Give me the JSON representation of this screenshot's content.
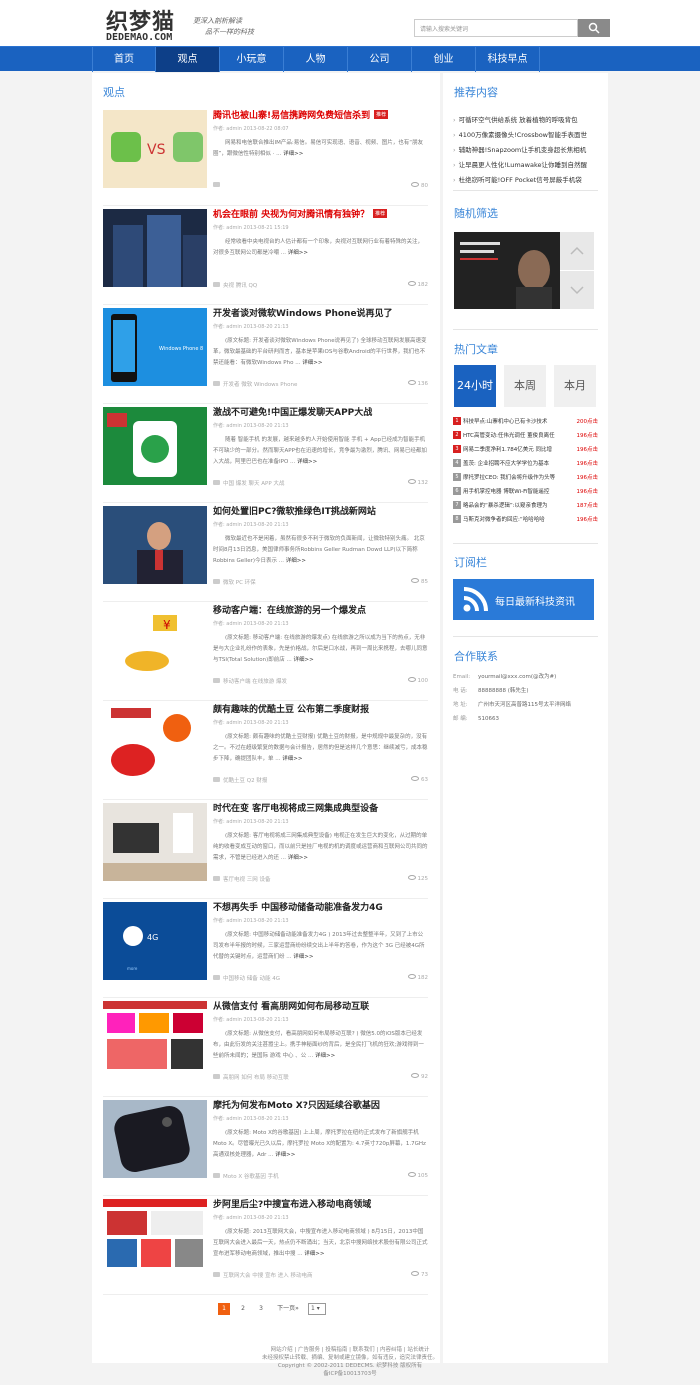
{
  "header": {
    "logo_cn": "织梦猫",
    "logo_en": "DEDEMAO.COM",
    "slogan1": "更深入剖析解读",
    "slogan2": "品不一样的科技",
    "search_placeholder": "请输入搜索关键词"
  },
  "nav": [
    "首页",
    "观点",
    "小玩意",
    "人物",
    "公司",
    "创业",
    "科技早点"
  ],
  "nav_active": "观点",
  "main": {
    "section_title": "观点",
    "articles": [
      {
        "title": "腾讯也被山寨!易信携跨网免费短信杀到",
        "hot": "推荐",
        "meta": "作者: admin  2013-08-22 08:07",
        "summary": "网易和电信联合推出IM产品:易信。易信可实现语、语音、视频、图片，也有“朋友圈”，跟微信性特别相似 · ...",
        "tags": "",
        "views": "80"
      },
      {
        "title": "机会在眼前 央视为何对腾讯情有独钟？",
        "hot": "推荐",
        "meta": "作者: admin  2013-08-21 15:19",
        "summary": "经常收看中央电视台的人估计都有一个印象，央视对互联网行业有着特殊的关注，对很多互联网公司都是冷嘲 ...",
        "tags": "央视  腾讯  QQ",
        "views": "182"
      },
      {
        "title": "开发者谈对微软Windows Phone说再见了",
        "hot": "",
        "meta": "作者: admin  2013-08-20 21:13",
        "summary": "(原文标题: 开发者谈对微软Windows Phone说再见了) 全球移动互联网发展高速变革，微软最基础的平台研判而言，基本是苹果iOS与谷歌Android的平行世界，我们也不禁还能看：有微软Windows Pho ...",
        "tags": "开发者  微软  Windows Phone",
        "views": "136"
      },
      {
        "title": "激战不可避免!中国正爆发聊天APP大战",
        "hot": "",
        "meta": "作者: admin  2013-08-20 21:13",
        "summary": "随着 智能手机 的发展，越来越多的人开始使用智能 手机 + App已经成为智能手机不可缺少的一部分。然而聊天APP也在迅速的增长，竞争最为激烈，腾讯、网易已经都加入大战，阿里巴巴也在准备IPO ...",
        "tags": "中国  爆发  聊天  APP  大战",
        "views": "132"
      },
      {
        "title": "如何处置旧PC?微软推绿色IT挑战新网站",
        "hot": "",
        "meta": "作者: admin  2013-08-20 21:13",
        "summary": "微软最近也不是闲着，虽然有很多不利于微软的负面新闻，让微软特别头痛。 北京时间8月13日消息，美国律师事务所Robbins Geller Rudman Dowd LLP(以下简称Robbins Geller)今日表示 ...",
        "tags": "微软  PC  环保",
        "views": "85"
      },
      {
        "title": "移动客户端：在线旅游的另一个爆发点",
        "hot": "",
        "meta": "作者: admin  2013-08-20 21:13",
        "summary": "(原文标题: 移动客户端: 在线旅游的爆发点) 在线旅游之所以成为当下的热点，无非是与大企业扎纷作的表象，先是价格战，尔后是口水战，再到一周比来携程，去哪儿同意与TSI(Total Solution)即前店 ...",
        "tags": "移动客户端  在线旅游  爆发",
        "views": "100"
      },
      {
        "title": "颇有趣味的优酷土豆 公布第二季度财报",
        "hot": "",
        "meta": "作者: admin  2013-08-20 21:13",
        "summary": "(原文标题: 颇有趣味的优酷土豆财报) 优酷土豆的财报，是中规规中最复杂的，没有之一。不过在超级繁复的数据与会计报告，居然的但是这样几个意思：继续减亏，成本稳步下降，确提团队丰，单 ...",
        "tags": "优酷土豆  Q2  财报",
        "views": "63"
      },
      {
        "title": "时代在变 客厅电视将成三网集成典型设备",
        "hot": "",
        "meta": "作者: admin  2013-08-20 21:13",
        "summary": "(原文标题: 客厅电视将成三网集成典型设备) 电视正在发生巨大的变化，从过期的单纯的收看变成互动的窗口，而以前只是挂厂电视的机的调度或运营商和互联网公司共同的需求，不管是已经进入的还 ...",
        "tags": "客厅电视  三网  设备",
        "views": "125"
      },
      {
        "title": "不想再失手 中国移动储备动能准备发力4G",
        "hot": "",
        "meta": "作者: admin  2013-08-20 21:13",
        "summary": "(原文标题: 中国移动储备动能准备发力4G ) 2013年过去整整半年，又到了上市公司发布半年报的时候，三家运营商纷纷续交出上半年的答卷，作为这个 3G 已经被4G所代替的关键时点，运营商们纷 ...",
        "tags": "中国移动  储备  动能  4G",
        "views": "182"
      },
      {
        "title": "从微信支付 看高朋网如何布局移动互联",
        "hot": "",
        "meta": "作者: admin  2013-08-20 21:13",
        "summary": "(原文标题: 从微信支付，看高朋网如何布局移动互联? ) 微信5.0的iOS版本已经发布，由此衍发的关注甚嚣尘上。携手神秘面纱的背后，是全民打飞机的狂欢;游戏得到一些前所未闻的；是国际 游戏 中心 、公 ...",
        "tags": "高朋网  如何  布局  移动互联",
        "views": "92"
      },
      {
        "title": "摩托为何发布Moto X?只因延续谷歌基因",
        "hot": "",
        "meta": "作者: admin  2013-08-20 21:13",
        "summary": "(原文标题: Moto X的谷歌基因) 上上周，摩托罗拉在纽约正式发布了新旗舰手机Moto X。尽管曝光已久以后，摩托罗拉 Moto X的配置为: 4.7英寸720p屏幕，1.7GHz高通双核处理器，Adr ...",
        "tags": "Moto X  谷歌基因  手机",
        "views": "105"
      },
      {
        "title": "步阿里后尘?中搜宣布进入移动电商领域",
        "hot": "",
        "meta": "作者: admin  2013-08-20 21:13",
        "summary": "(原文标题: 2013互联网大会，中搜宣布进入移动电商领域 ) 8月15日，2013中国互联网大会进入最后一天，热点仍不断涌出；当天，北京中搜网络技术股份有限公司正式宣布进军移动电商领域，推出中搜 ...",
        "tags": "互联网大会  中搜  宣布  进入  移动电商",
        "views": "73"
      }
    ]
  },
  "pager": {
    "pages": [
      "1",
      "2",
      "3"
    ],
    "current": "1",
    "next": "下一页»",
    "select": "1"
  },
  "side": {
    "rec_title": "推荐内容",
    "rec_items": [
      "可循环空气供给系统 放着植物的呼吸背包",
      "4100万像素摄像头!Crossbow智能手表面世",
      "辅助神器!Snapzoom让手机变身超长焦相机",
      "让早晨更人性化!Lumawake让你睡到自然醒",
      "杜绝窃听可能!OFF Pocket信号屏蔽手机袋"
    ],
    "rand_title": "随机筛选",
    "hot_title": "热门文章",
    "hot_tabs": [
      "24小时",
      "本周",
      "本月"
    ],
    "hot_items": [
      {
        "n": "1",
        "t": "科技早点:山寨机中心已有卡沙技术",
        "c": "200点击"
      },
      {
        "n": "2",
        "t": "HTC高管变动:任伟光调任 董俊良离任",
        "c": "196点击"
      },
      {
        "n": "3",
        "t": "网易二季度净利1.784亿美元 同比增",
        "c": "196点击"
      },
      {
        "n": "4",
        "t": "盖茨: 企业招聘不应大学学位为基本",
        "c": "196点击"
      },
      {
        "n": "5",
        "t": "摩托罗拉CEO: 我们会将升级作为头等",
        "c": "196点击"
      },
      {
        "n": "6",
        "t": "用手机掌控电器 博联Wi-Fi智能遥控",
        "c": "196点击"
      },
      {
        "n": "7",
        "t": "略品会的“暴杀逻辑”:以窥亲食理为",
        "c": "187点击"
      },
      {
        "n": "8",
        "t": "马斯克对微争者的回应:“哈哈哈哈",
        "c": "196点击"
      }
    ],
    "sub_title": "订阅栏",
    "sub_label": "每日最新科技资讯",
    "contact_title": "合作联系",
    "contact": [
      {
        "lb": "Email:",
        "v": "yourmail@xxx.com(@改为#)"
      },
      {
        "lb": "电 话:",
        "v": "88888888 (韩先生)"
      },
      {
        "lb": "地 址:",
        "v": "广州市天河区高普路115号太平洋网络"
      },
      {
        "lb": "邮 编:",
        "v": "510663"
      }
    ]
  },
  "footer": {
    "links": "网站介绍 | 广告服务 | 投稿指南 | 联系我们 | 内容纠错 | 站长统计",
    "line2": "未经授权禁止转载、摘编、复制或建立镜像，如有违反，追究法律责任。",
    "line3": "Copyright © 2002-2011 DEDECMS. 织梦科技 版权所有",
    "line4": "备ICP备10013703号"
  },
  "colors": {
    "brand": "#1a62c0",
    "nav_active": "#0d3f88",
    "hot": "#d82020",
    "accent_title": "#3a86d8",
    "page_current": "#f06010"
  }
}
